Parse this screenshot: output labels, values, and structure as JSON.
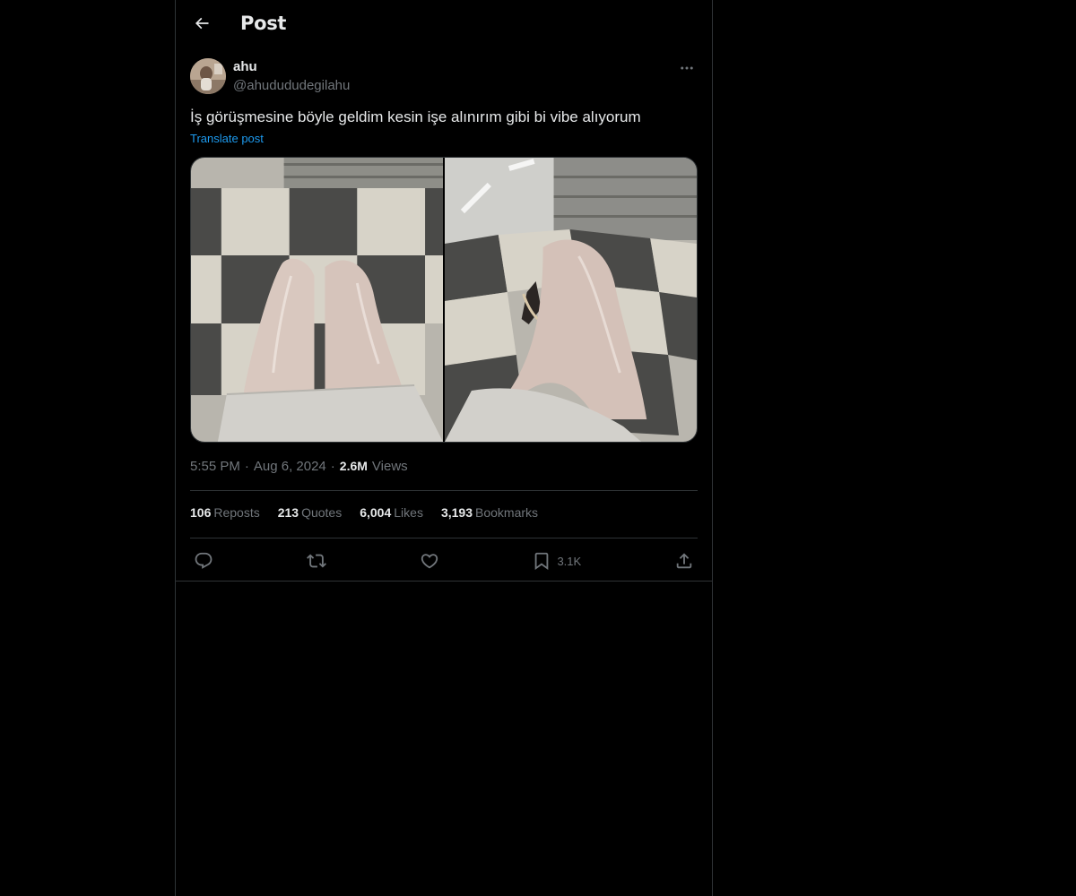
{
  "header": {
    "title": "Post"
  },
  "author": {
    "name": "ahu",
    "handle": "@ahudududegilahu"
  },
  "post": {
    "text": "İş görüşmesine böyle geldim kesin işe alınırım gibi bi vibe alıyorum",
    "translate_label": "Translate post"
  },
  "meta": {
    "time": "5:55 PM",
    "separator": "·",
    "date": "Aug 6, 2024",
    "views_count": "2.6M",
    "views_label": "Views"
  },
  "stats": {
    "reposts_count": "106",
    "reposts_label": "Reposts",
    "quotes_count": "213",
    "quotes_label": "Quotes",
    "likes_count": "6,004",
    "likes_label": "Likes",
    "bookmarks_count": "3,193",
    "bookmarks_label": "Bookmarks"
  },
  "actions": {
    "bookmark_count": "3.1K"
  },
  "icons": [
    "back-arrow-icon",
    "more-icon",
    "reply-icon",
    "repost-icon",
    "like-icon",
    "bookmark-icon",
    "share-icon"
  ],
  "colors": {
    "background": "#000000",
    "text": "#e7e9ea",
    "muted": "#71767b",
    "link": "#1d9bf0",
    "border": "#2f3336"
  }
}
